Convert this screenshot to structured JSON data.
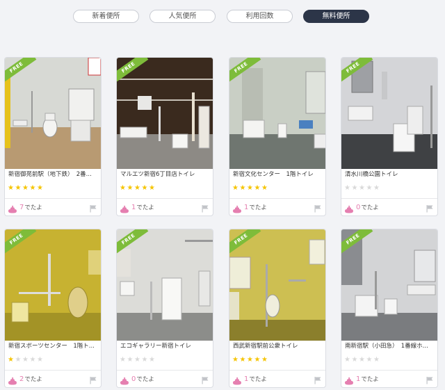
{
  "tabs": [
    {
      "label": "新着便所",
      "active": false
    },
    {
      "label": "人気便所",
      "active": false
    },
    {
      "label": "利用回数",
      "active": false
    },
    {
      "label": "無料便所",
      "active": true
    }
  ],
  "badge_label": "FREE",
  "count_suffix": "でたよ",
  "colors": {
    "star": "#f5c400",
    "poop": "#e57fb0",
    "badge": "#7ebc3a",
    "active_tab": "#2c3548"
  },
  "icons": {
    "badge": "free-badge",
    "reaction": "poop-icon",
    "report": "flag-icon",
    "rating": "star-icon"
  },
  "cards": [
    {
      "name": "新宿御苑前駅（地下鉄）　2番...",
      "rating": 5,
      "count": "7"
    },
    {
      "name": "マルエツ新宿6丁目店トイレ",
      "rating": 5,
      "count": "1"
    },
    {
      "name": "新宿文化センター　1階トイレ",
      "rating": 5,
      "count": "1"
    },
    {
      "name": "清水川橋公園トイレ",
      "rating": 0,
      "count": "0"
    },
    {
      "name": "新宿スポーツセンター　1階ト...",
      "rating": 1,
      "count": "2"
    },
    {
      "name": "エコギャラリー新宿トイレ",
      "rating": 0,
      "count": "0"
    },
    {
      "name": "西武新宿駅前公衆トイレ",
      "rating": 5,
      "count": "1"
    },
    {
      "name": "南新宿駅（小田急）　1番線ホ...",
      "rating": 0,
      "count": "1"
    }
  ]
}
